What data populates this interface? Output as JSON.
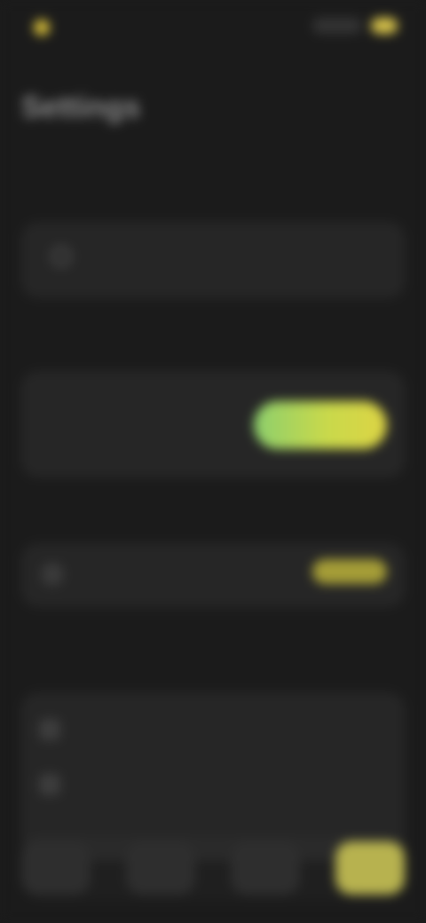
{
  "status": {
    "app_name": ""
  },
  "page": {
    "title": "Settings"
  },
  "sections": {
    "search_label": "",
    "toggle_label": "",
    "update_label": "",
    "feature_label": ""
  },
  "search": {
    "placeholder": ""
  },
  "toggle": {
    "title": "",
    "subtitle": ""
  },
  "update": {
    "text": "",
    "action": ""
  },
  "features": [
    {
      "label": ""
    },
    {
      "label": ""
    }
  ],
  "colors": {
    "background": "#1b1b1b",
    "card": "#262626",
    "accent": "#d6c24a",
    "toggle_start": "#8ccf6d",
    "toggle_end": "#ddd444"
  }
}
